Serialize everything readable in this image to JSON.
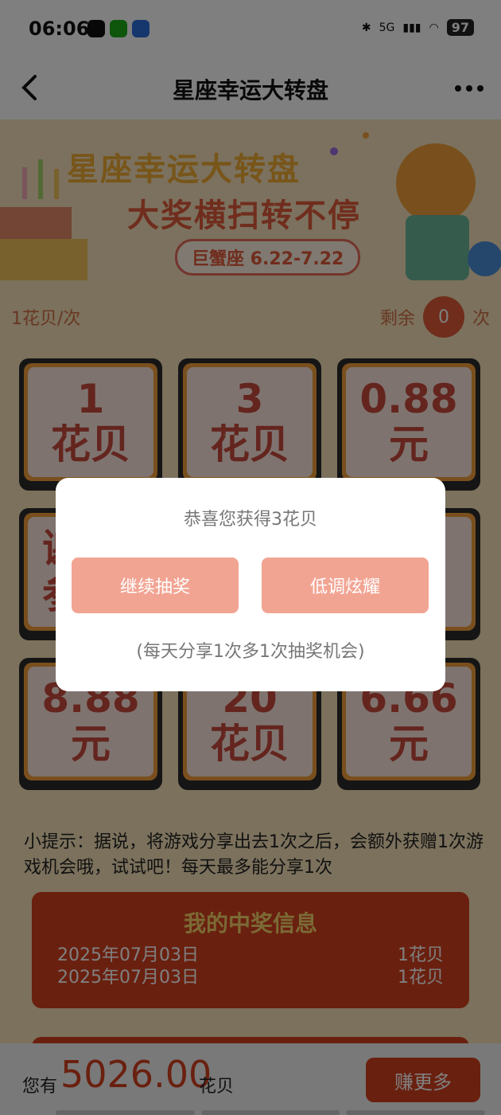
{
  "status_bar": {
    "time": "06:06",
    "network": "5G",
    "battery": "97"
  },
  "nav": {
    "title": "星座幸运大转盘"
  },
  "banner": {
    "title": "星座幸运大转盘",
    "subtitle": "大奖横扫转不停",
    "sign": "巨蟹座 6.22-7.22"
  },
  "game": {
    "cost_label": "1花贝/次",
    "remain_prefix": "剩余",
    "remain_count": "0",
    "remain_suffix": "次",
    "prizes": [
      {
        "value": "1",
        "unit": "花贝"
      },
      {
        "value": "3",
        "unit": "花贝"
      },
      {
        "value": "0.88",
        "unit": "元"
      },
      {
        "value": "谢",
        "unit": "参"
      },
      {
        "value": "",
        "unit": ""
      },
      {
        "value": "",
        "unit": ""
      },
      {
        "value": "8.88",
        "unit": "元"
      },
      {
        "value": "20",
        "unit": "花贝"
      },
      {
        "value": "6.66",
        "unit": "元"
      }
    ]
  },
  "tip": "小提示：据说，将游戏分享出去1次之后，会额外获赠1次游戏机会哦，试试吧！每天最多能分享1次",
  "win_info": {
    "title": "我的中奖信息",
    "rows": [
      {
        "date": "2025年07月03日",
        "prize": "1花贝"
      },
      {
        "date": "2025年07月03日",
        "prize": "1花贝"
      }
    ]
  },
  "bottom": {
    "you_have": "您有",
    "amount": "5026.00",
    "unit": "花贝",
    "earn_more": "赚更多"
  },
  "modal": {
    "message": "恭喜您获得3花贝",
    "continue_label": "继续抽奖",
    "show_off_label": "低调炫耀",
    "note": "(每天分享1次多1次抽奖机会)"
  }
}
